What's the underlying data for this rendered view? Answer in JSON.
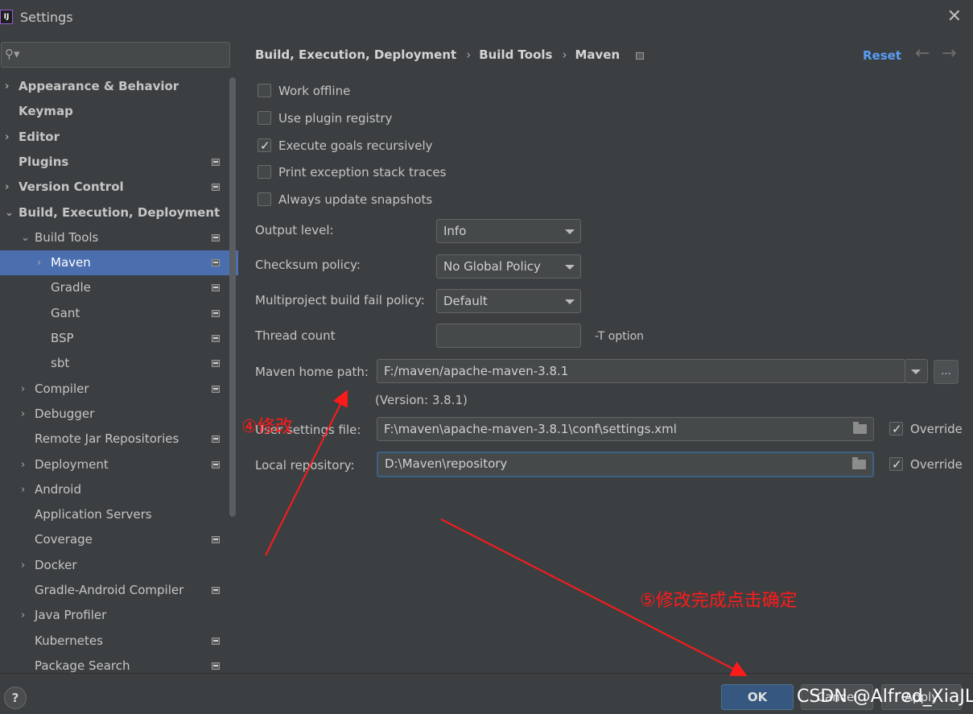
{
  "window": {
    "title": "Settings",
    "app_icon_text": "IJ"
  },
  "search": {
    "placeholder": ""
  },
  "sidebar": {
    "items": [
      {
        "label": "Appearance & Behavior",
        "chevron": "›",
        "bold": true
      },
      {
        "label": "Keymap",
        "chevron": "",
        "bold": true
      },
      {
        "label": "Editor",
        "chevron": "›",
        "bold": true
      },
      {
        "label": "Plugins",
        "chevron": "",
        "bold": true
      },
      {
        "label": "Version Control",
        "chevron": "›",
        "bold": true
      },
      {
        "label": "Build, Execution, Deployment",
        "chevron": "⌄",
        "bold": true
      },
      {
        "label": "Build Tools",
        "chevron": "⌄"
      },
      {
        "label": "Maven",
        "chevron": "›",
        "selected": true
      },
      {
        "label": "Gradle",
        "chevron": ""
      },
      {
        "label": "Gant",
        "chevron": ""
      },
      {
        "label": "BSP",
        "chevron": ""
      },
      {
        "label": "sbt",
        "chevron": ""
      },
      {
        "label": "Compiler",
        "chevron": "›"
      },
      {
        "label": "Debugger",
        "chevron": "›"
      },
      {
        "label": "Remote Jar Repositories",
        "chevron": ""
      },
      {
        "label": "Deployment",
        "chevron": "›"
      },
      {
        "label": "Android",
        "chevron": "›"
      },
      {
        "label": "Application Servers",
        "chevron": ""
      },
      {
        "label": "Coverage",
        "chevron": ""
      },
      {
        "label": "Docker",
        "chevron": "›"
      },
      {
        "label": "Gradle-Android Compiler",
        "chevron": ""
      },
      {
        "label": "Java Profiler",
        "chevron": "›"
      },
      {
        "label": "Kubernetes",
        "chevron": ""
      },
      {
        "label": "Package Search",
        "chevron": ""
      }
    ]
  },
  "breadcrumb": {
    "part1": "Build, Execution, Deployment",
    "part2": "Build Tools",
    "part3": "Maven",
    "separator": "›"
  },
  "header": {
    "reset_label": "Reset",
    "back_icon": "←",
    "forward_icon": "→"
  },
  "options": {
    "work_offline": {
      "label": "Work offline",
      "checked": false
    },
    "use_plugin_registry": {
      "label": "Use plugin registry",
      "checked": false
    },
    "execute_goals": {
      "label": "Execute goals recursively",
      "checked": true
    },
    "print_exception": {
      "label": "Print exception stack traces",
      "checked": false
    },
    "always_update": {
      "label": "Always update snapshots",
      "checked": false
    }
  },
  "fields": {
    "output_level": {
      "label": "Output level:",
      "value": "Info"
    },
    "checksum_policy": {
      "label": "Checksum policy:",
      "value": "No Global Policy"
    },
    "fail_policy": {
      "label": "Multiproject build fail policy:",
      "value": "Default"
    },
    "thread_count": {
      "label": "Thread count",
      "value": "",
      "hint": "-T option"
    },
    "maven_home": {
      "label": "Maven home path:",
      "value": "F:/maven/apache-maven-3.8.1",
      "version": "(Version: 3.8.1)",
      "browse": "..."
    },
    "user_settings": {
      "label": "User settings file:",
      "value": "F:\\maven\\apache-maven-3.8.1\\conf\\settings.xml",
      "override_label": "Override",
      "override_checked": true
    },
    "local_repo": {
      "label": "Local repository:",
      "value": "D:\\Maven\\repository",
      "override_label": "Override",
      "override_checked": true
    }
  },
  "footer": {
    "help": "?",
    "ok": "OK",
    "cancel": "Cancel",
    "apply": "Apply"
  },
  "annotations": {
    "step4": "④修改",
    "step5": "⑤修改完成点击确定",
    "watermark": "CSDN @Alfred_XiaJL"
  },
  "colors": {
    "selection": "#4b6eaf",
    "accent_link": "#589df6",
    "annotation": "#ff1a1a",
    "ok_button": "#365880"
  }
}
